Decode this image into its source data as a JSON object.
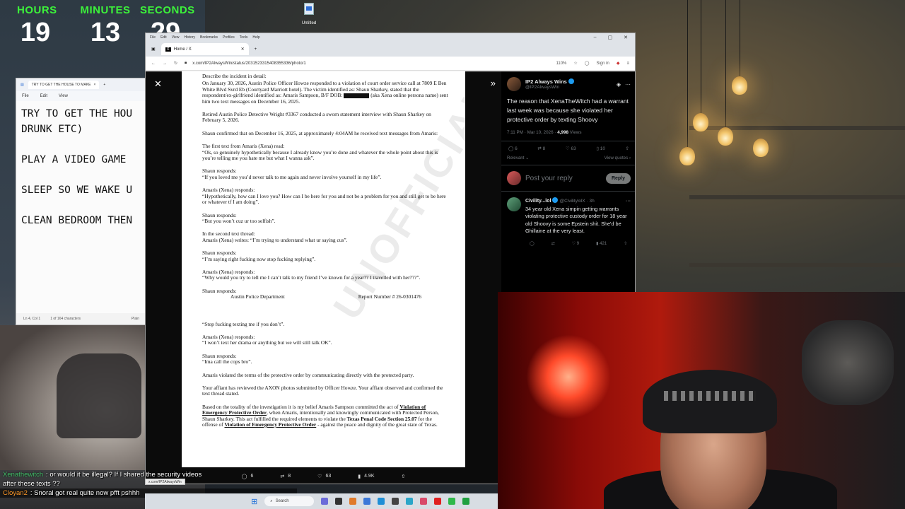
{
  "clock": {
    "hours_label": "HOURS",
    "hours": "19",
    "minutes_label": "MINUTES",
    "minutes": "13",
    "seconds_label": "SECONDS",
    "seconds": "29"
  },
  "desktop_icon": {
    "label": "Untitled"
  },
  "notepad": {
    "tab_title": "TRY TO GET THE HOUSE TO MAKE",
    "menu": [
      "File",
      "Edit",
      "View"
    ],
    "body": "TRY TO GET THE HOU\nDRUNK ETC)\n\nPLAY A VIDEO GAME\n\nSLEEP SO WE WAKE U\n\nCLEAN BEDROOM THEN",
    "status_pos": "Ln 4, Col 1",
    "status_chars": "1 of 164 characters",
    "status_format": "Plain"
  },
  "browser": {
    "menu": [
      "File",
      "Edit",
      "View",
      "History",
      "Bookmarks",
      "Profiles",
      "Tools",
      "Help"
    ],
    "tab_title": "Home / X",
    "url": "x.com/IP2AlwaysWin/status/2031523315408355336/photo/1",
    "zoom": "110%",
    "sign_in": "Sign in"
  },
  "document": {
    "para1": "Describe the incident in detail:",
    "para2": "On January 30, 2026, Austin Police Officer Howze responded to a violation of court order service call at 7809 E Ben White Blvd Svrd Eb (Courtyard Marriott hotel). The victim identified as: Shaun Sharkey, stated that the respondent/ex-girlfriend identified as: Amaris Sampson, B/F DOB:",
    "para2b": "(aka Xena online persona name) sent him two text messages on December 16, 2025.",
    "para3": "Retired Austin Police Detective Wright #3367 conducted a sworn statement interview with Shaun Sharkey on February 5, 2026.",
    "para4": "Shaun confirmed that on December 16, 2025, at approximately 4:04AM he received text messages from Amaris:",
    "para5a": "The first text from Amaris (Xena) read:",
    "para5b": "“Ok, so genuinely hypothetically because I already know you’re done and whatever the whole point about this is you’re telling me you hate me but what I wanna ask”.",
    "para6a": "Shaun responds:",
    "para6b": "“If you loved me you’d never talk to me again and never involve yourself in my life”.",
    "para7a": "Amaris (Xena) responds:",
    "para7b": "“Hypothetically, how can I love you? How can I be here for you and not be a problem for you and still get to be here or whatever tf I am doing”.",
    "para8a": "Shaun responds:",
    "para8b": "“But you won’t cuz ur too selfish”.",
    "para9a": "In the second text thread:",
    "para9b": "Amaris (Xena) writes: “I’m trying to understand what ur saying cus”.",
    "para10a": "Shaun responds:",
    "para10b": "“I’m saying right fucking now stop fucking replying”.",
    "para11a": "Amaris (Xena) responds:",
    "para11b": "“Why would you try to tell me I can’t talk to my friend I’ve known for a year?? I travelled with her???”.",
    "para12a": "Shaun responds:",
    "header_left": "Austin Police Department",
    "header_right": "Report Number # 26-0301476",
    "para13": "“Stop fucking texting me if you don’t”.",
    "para14a": "Amaris (Xena) responds:",
    "para14b": "“I won’t text her drama or anything but we will still talk OK”.",
    "para15a": "Shaun responds:",
    "para15b": "“Ima call the cops bro”.",
    "para16": "Amaris violated the terms of the protective order by communicating directly with the protected party.",
    "para17": "Your affiant has reviewed the AXON photos submitted by Officer Howze. Your affiant observed and confirmed the text thread stated.",
    "para18a": "Based on the totality of the investigation it is my belief Amaris Sampson committed the act of",
    "para18u1": "Violation of Emergency Protective Order",
    "para18b": ", when Amaris, intentionally and knowingly communicated with Protected Person, Shaun Sharkey. This act fulfilled the required elements to violate the",
    "para18c": "Texas Penal Code Section 25.07",
    "para18d": "for the offense of",
    "para18u2": "Violation of Emergency Protective Order",
    "para18e": "- against the peace and dignity of the great state of Texas.",
    "watermark": "UNOFFICIAL"
  },
  "viewer_actions": {
    "replies": "6",
    "reposts": "8",
    "likes": "63",
    "views": "4.9K"
  },
  "tweet": {
    "name": "IP2 Always Wins",
    "handle": "@IP2AlwaysWin",
    "text": "The reason that XenaTheWitch had a warrant last week was because she violated her protective order by texting Shoovy",
    "time": "7:11 PM · Mar 10, 2026 ·",
    "views_num": "4,998",
    "views_label": "Views",
    "replies": "6",
    "reposts": "8",
    "likes": "63",
    "bookmarks": "10",
    "sort": "Relevant",
    "view_quotes": "View quotes",
    "reply_placeholder": "Post your reply",
    "reply_button": "Reply"
  },
  "reply": {
    "name": "Civility...lol",
    "handle": "@CivilitylolX · 3h",
    "text": "34 year old Xena simpin getting warrants violating protective custody order for 18 year old Shoovy is some Epstein shit. She'd be Ghillaine at the very least.",
    "likes": "9",
    "views": "421"
  },
  "chat": {
    "user1": "Xenathewitch",
    "msg1": ": or would it be illegal? If I shared the security videos",
    "msg1b": "after these texts ??",
    "user2": "Cloyan2",
    "msg2": ": Snoral got real quite now pfft pshhh"
  },
  "taskbar": {
    "search": "Search"
  },
  "url_tooltip": "x.com/IP2AlwaysWin"
}
